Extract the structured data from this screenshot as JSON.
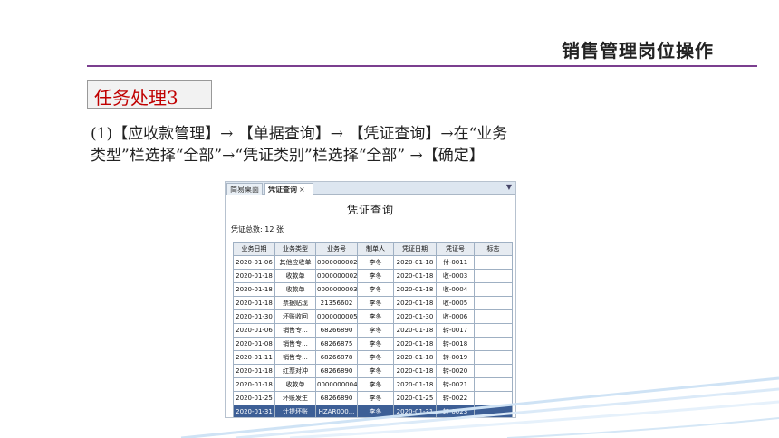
{
  "slide": {
    "title": "销售管理岗位操作",
    "task_label": "任务处理3",
    "instruction_line1": "(1)【应收款管理】→ 【单据查询】→ 【凭证查询】→在“业务",
    "instruction_line2": "类型”栏选择“全部”→“凭证类别”栏选择“全部” →【确定】",
    "colors": {
      "accent": "#7b3f8f",
      "task_text": "#c00000",
      "selected_row": "#3d5f96"
    }
  },
  "app": {
    "tabs": [
      {
        "label": "简易桌面"
      },
      {
        "label": "凭证查询",
        "close": "×"
      }
    ],
    "tab_menu_icon": "▼",
    "heading": "凭证查询",
    "total": "凭证总数: 12 张",
    "columns": [
      "业务日期",
      "业务类型",
      "业务号",
      "制单人",
      "凭证日期",
      "凭证号",
      "标志"
    ],
    "rows": [
      [
        "2020-01-06",
        "其他应收单",
        "0000000002",
        "李冬",
        "2020-01-18",
        "付-0011",
        ""
      ],
      [
        "2020-01-18",
        "收款单",
        "0000000002",
        "李冬",
        "2020-01-18",
        "收-0003",
        ""
      ],
      [
        "2020-01-18",
        "收款单",
        "0000000003",
        "李冬",
        "2020-01-18",
        "收-0004",
        ""
      ],
      [
        "2020-01-18",
        "票据贴现",
        "21356602",
        "李冬",
        "2020-01-18",
        "收-0005",
        ""
      ],
      [
        "2020-01-30",
        "坏账收回",
        "0000000005",
        "李冬",
        "2020-01-30",
        "收-0006",
        ""
      ],
      [
        "2020-01-06",
        "销售专...",
        "68266890",
        "李冬",
        "2020-01-18",
        "转-0017",
        ""
      ],
      [
        "2020-01-08",
        "销售专...",
        "68266875",
        "李冬",
        "2020-01-18",
        "转-0018",
        ""
      ],
      [
        "2020-01-11",
        "销售专...",
        "68266878",
        "李冬",
        "2020-01-18",
        "转-0019",
        ""
      ],
      [
        "2020-01-18",
        "红票对冲",
        "68266890",
        "李冬",
        "2020-01-18",
        "转-0020",
        ""
      ],
      [
        "2020-01-18",
        "收款单",
        "0000000004",
        "李冬",
        "2020-01-18",
        "转-0021",
        ""
      ],
      [
        "2020-01-25",
        "坏账发生",
        "68266890",
        "李冬",
        "2020-01-25",
        "转-0022",
        ""
      ],
      [
        "2020-01-31",
        "计提坏账",
        "HZAR000...",
        "李冬",
        "2020-01-31",
        "转-0023",
        ""
      ]
    ],
    "selected_row_index": 11
  }
}
